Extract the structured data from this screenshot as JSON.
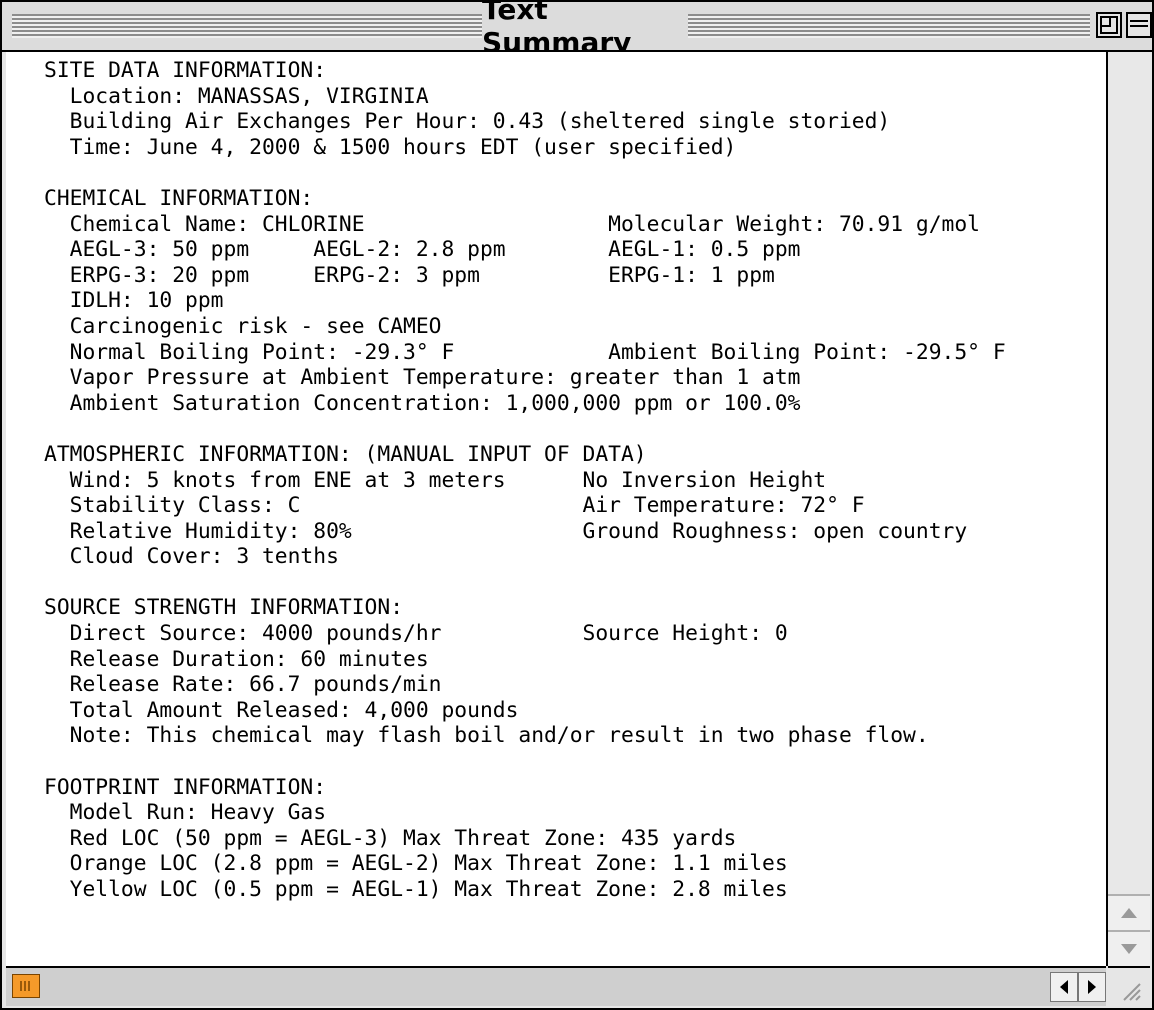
{
  "window": {
    "title": "Text Summary"
  },
  "summary": {
    "lines": [
      "SITE DATA INFORMATION:",
      "  Location: MANASSAS, VIRGINIA",
      "  Building Air Exchanges Per Hour: 0.43 (sheltered single storied)",
      "  Time: June 4, 2000 & 1500 hours EDT (user specified)",
      "",
      "CHEMICAL INFORMATION:",
      "  Chemical Name: CHLORINE                   Molecular Weight: 70.91 g/mol",
      "  AEGL-3: 50 ppm     AEGL-2: 2.8 ppm        AEGL-1: 0.5 ppm",
      "  ERPG-3: 20 ppm     ERPG-2: 3 ppm          ERPG-1: 1 ppm",
      "  IDLH: 10 ppm",
      "  Carcinogenic risk - see CAMEO",
      "  Normal Boiling Point: -29.3° F            Ambient Boiling Point: -29.5° F",
      "  Vapor Pressure at Ambient Temperature: greater than 1 atm",
      "  Ambient Saturation Concentration: 1,000,000 ppm or 100.0%",
      "",
      "ATMOSPHERIC INFORMATION: (MANUAL INPUT OF DATA)",
      "  Wind: 5 knots from ENE at 3 meters      No Inversion Height",
      "  Stability Class: C                      Air Temperature: 72° F",
      "  Relative Humidity: 80%                  Ground Roughness: open country",
      "  Cloud Cover: 3 tenths",
      "",
      "SOURCE STRENGTH INFORMATION:",
      "  Direct Source: 4000 pounds/hr           Source Height: 0",
      "  Release Duration: 60 minutes",
      "  Release Rate: 66.7 pounds/min",
      "  Total Amount Released: 4,000 pounds",
      "  Note: This chemical may flash boil and/or result in two phase flow.",
      "",
      "FOOTPRINT INFORMATION:",
      "  Model Run: Heavy Gas",
      "  Red LOC (50 ppm = AEGL-3) Max Threat Zone: 435 yards",
      "  Orange LOC (2.8 ppm = AEGL-2) Max Threat Zone: 1.1 miles",
      "  Yellow LOC (0.5 ppm = AEGL-1) Max Threat Zone: 2.8 miles"
    ]
  },
  "icons": {
    "zoom": "zoom-box-icon",
    "collapse": "windowshade-icon",
    "scroll_up": "arrow-up-icon",
    "scroll_down": "arrow-down-icon",
    "scroll_left": "arrow-left-icon",
    "scroll_right": "arrow-right-icon",
    "grow": "resize-grip-icon",
    "thumb": "scroll-thumb-grip-icon"
  },
  "colors": {
    "thumb": "#f59a2a",
    "title_bar": "#dcdcdc"
  }
}
